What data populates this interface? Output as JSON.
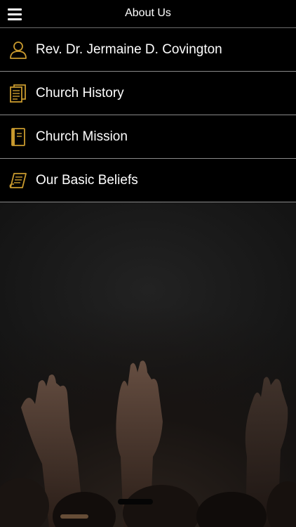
{
  "header": {
    "title": "About Us",
    "menu_icon": "hamburger-menu-icon"
  },
  "menu": {
    "items": [
      {
        "label": "Rev. Dr. Jermaine D. Covington",
        "icon": "person-icon"
      },
      {
        "label": "Church History",
        "icon": "documents-icon"
      },
      {
        "label": "Church Mission",
        "icon": "book-icon"
      },
      {
        "label": "Our Basic Beliefs",
        "icon": "scroll-icon"
      }
    ]
  },
  "colors": {
    "accent": "#c99a2e",
    "background": "#000000",
    "divider": "#8a8a8a"
  }
}
